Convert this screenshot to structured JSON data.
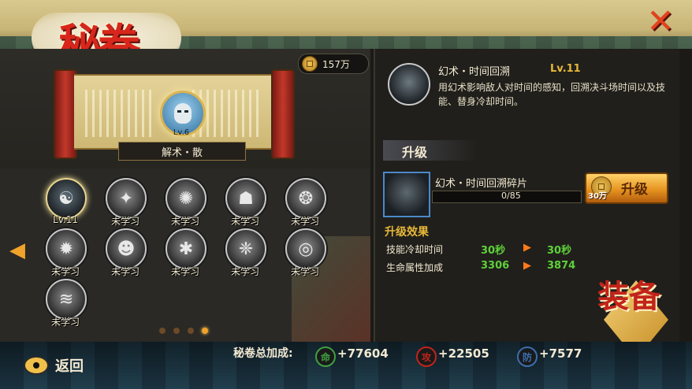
{
  "header": {
    "title": "秘卷",
    "close_icon": "close-x-icon"
  },
  "currency": {
    "value": "157万",
    "icon": "coin-icon"
  },
  "scroll": {
    "level": "Lv.6",
    "name": "解术・散"
  },
  "skills": [
    {
      "label": "Lv.11",
      "active": true,
      "glyph": "☯"
    },
    {
      "label": "未学习",
      "glyph": "✦"
    },
    {
      "label": "未学习",
      "glyph": "✺"
    },
    {
      "label": "未学习",
      "glyph": "☗"
    },
    {
      "label": "未学习",
      "glyph": "❂"
    },
    {
      "label": "未学习",
      "glyph": "✹"
    },
    {
      "label": "未学习",
      "glyph": "☻"
    },
    {
      "label": "未学习",
      "glyph": "✱"
    },
    {
      "label": "未学习",
      "glyph": "❈"
    },
    {
      "label": "未学习",
      "glyph": "◎"
    },
    {
      "label": "未学习",
      "glyph": "≋"
    }
  ],
  "pagination": {
    "current": 4,
    "total": 4
  },
  "detail": {
    "name": "幻术・时间回溯",
    "level": "Lv.11",
    "description": "用幻术影响敌人对时间的感知，回溯决斗场时间以及技能、替身冷却时间。"
  },
  "upgrade": {
    "title": "升级",
    "fragment_name": "幻术・时间回溯碎片",
    "fragment_count": "0/85",
    "fragment_progress": 0,
    "cost": "30万",
    "button_label": "升级",
    "effect_title": "升级效果",
    "effects": [
      {
        "label": "技能冷却时间",
        "old": "30秒",
        "new": "30秒"
      },
      {
        "label": "生命属性加成",
        "old": "3306",
        "new": "3874"
      }
    ]
  },
  "equip_label": "装备",
  "footer": {
    "back_label": "返回",
    "bonus_label": "秘卷总加成:",
    "stats": [
      {
        "badge": "命",
        "value": "+77604",
        "color": "#3fa040"
      },
      {
        "badge": "攻",
        "value": "+22505",
        "color": "#c2241a"
      },
      {
        "badge": "防",
        "value": "+7577",
        "color": "#3a6fb0"
      }
    ]
  }
}
